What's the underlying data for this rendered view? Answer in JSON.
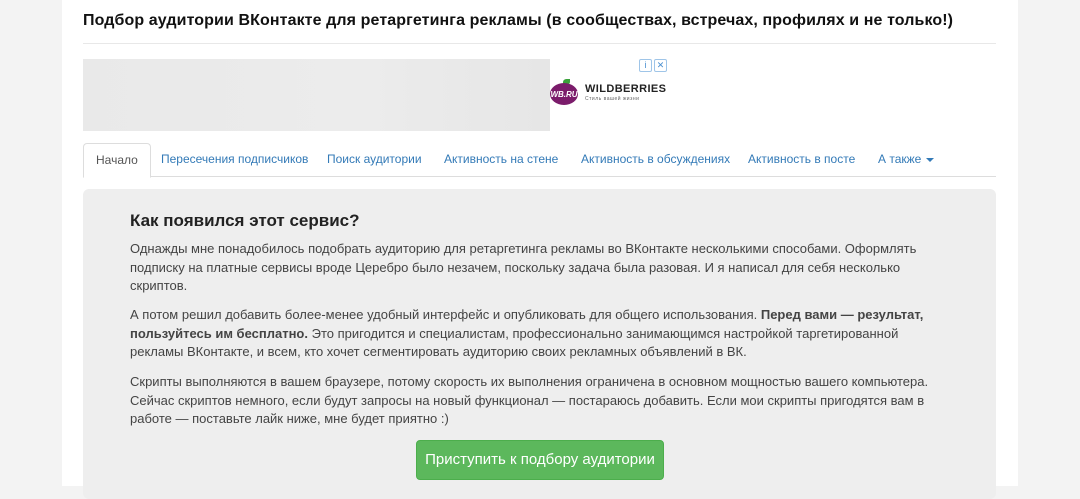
{
  "page": {
    "title": "Подбор аудитории ВКонтакте для ретаргетинга рекламы (в сообществах, встречах, профилях и не только!)"
  },
  "ad": {
    "brand": "WILDBERRIES",
    "badge": "WB.RU",
    "tagline": "Стиль вашей жизни",
    "info_icon": "info-icon",
    "close_icon": "close-icon"
  },
  "tabs": [
    {
      "label": "Начало",
      "active": true
    },
    {
      "label": "Пересечения подписчиков"
    },
    {
      "label": "Поиск аудитории"
    },
    {
      "label": "Активность на стене"
    },
    {
      "label": "Активность в обсуждениях"
    },
    {
      "label": "Активность в посте"
    },
    {
      "label": "А также"
    }
  ],
  "content": {
    "heading": "Как появился этот сервис?",
    "p1": "Однажды мне понадобилось подобрать аудиторию для ретаргетинга рекламы во ВКонтакте несколькими способами. Оформлять подписку на платные сервисы вроде Церебро было незачем, поскольку задача была разовая. И я написал для себя несколько скриптов.",
    "p2_start": "А потом решил добавить более-менее удобный интерфейс и опубликовать для общего использования. ",
    "p2_bold": "Перед вами — результат, пользуйтесь им бесплатно.",
    "p2_end": " Это пригодится и специалистам, профессионально занимающимся настройкой таргетированной рекламы ВКонтакте, и всем, кто хочет сегментировать аудиторию своих рекламных объявлений в ВК.",
    "p3": "Скрипты выполняются в вашем браузере, потому скорость их выполнения ограничена в основном мощностью вашего компьютера. Сейчас скриптов немного, если будут запросы на новый функционал — постараюсь добавить. Если мои скрипты пригодятся вам в работе — поставьте лайк ниже, мне будет приятно :)",
    "cta": "Приступить к подбору аудитории"
  }
}
